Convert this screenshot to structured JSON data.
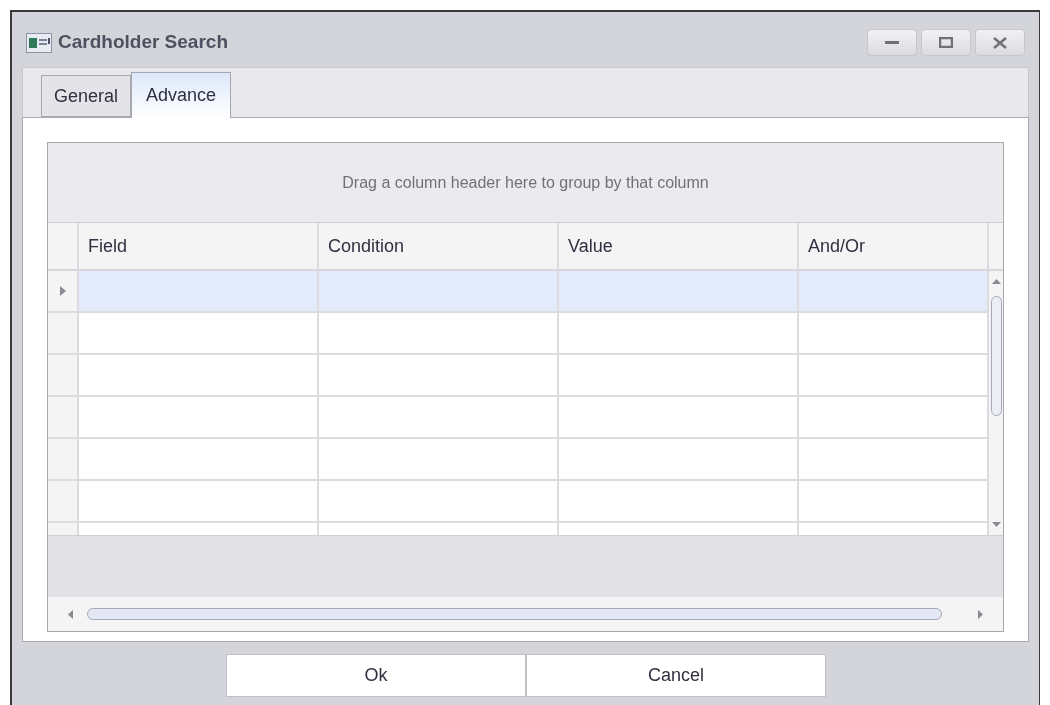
{
  "window": {
    "title": "Cardholder Search"
  },
  "tabs": [
    {
      "label": "General",
      "selected": false
    },
    {
      "label": "Advance",
      "selected": true
    }
  ],
  "grid": {
    "group_panel_hint": "Drag a column header here to group by that column",
    "columns": [
      "Field",
      "Condition",
      "Value",
      "And/Or"
    ],
    "rows": [
      {
        "selected": true
      },
      {
        "selected": false
      },
      {
        "selected": false
      },
      {
        "selected": false
      },
      {
        "selected": false
      },
      {
        "selected": false
      },
      {
        "selected": false
      }
    ]
  },
  "buttons": [
    "Ok",
    "Cancel"
  ]
}
